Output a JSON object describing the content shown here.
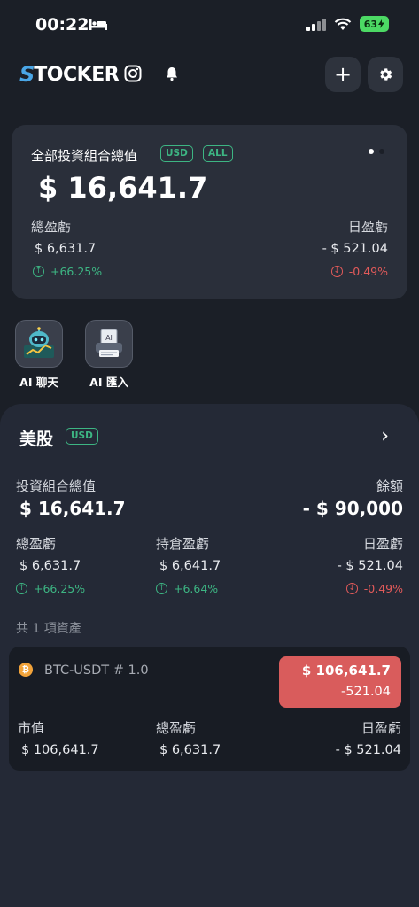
{
  "status": {
    "time": "00:22",
    "battery": "63"
  },
  "header": {
    "logo_s": "S",
    "logo_text": "TOCKER",
    "add_label": "+"
  },
  "portfolio": {
    "title": "全部投資組合總值",
    "tag_currency": "USD",
    "tag_scope": "ALL",
    "total": "$ 16,641.7",
    "total_pl_label": "總盈虧",
    "total_pl_value": "$ 6,631.7",
    "total_pl_pct": "+66.25%",
    "day_pl_label": "日盈虧",
    "day_pl_value": "- $ 521.04",
    "day_pl_pct": "-0.49%"
  },
  "ai": {
    "chat_label": "AI 聊天",
    "import_label": "AI 匯入"
  },
  "market": {
    "title": "美股",
    "tag": "USD",
    "chevron": "›",
    "value_label": "投資組合總值",
    "value": "$ 16,641.7",
    "balance_label": "餘額",
    "balance": "- $ 90,000",
    "total_pl_label": "總盈虧",
    "total_pl_value": "$ 6,631.7",
    "total_pl_pct": "+66.25%",
    "holding_pl_label": "持倉盈虧",
    "holding_pl_value": "$ 6,641.7",
    "holding_pl_pct": "+6.64%",
    "day_pl_label": "日盈虧",
    "day_pl_value": "- $ 521.04",
    "day_pl_pct": "-0.49%",
    "asset_count": "共 1 項資產"
  },
  "asset": {
    "icon_glyph": "₿",
    "name": "BTC-USDT",
    "qty": "# 1.0",
    "price": "$ 106,641.7",
    "change": "-521.04",
    "market_value_label": "市值",
    "market_value": "$ 106,641.7",
    "total_pl_label": "總盈虧",
    "total_pl_value": "$ 6,631.7",
    "day_pl_label": "日盈虧",
    "day_pl_value": "- $ 521.04"
  },
  "colors": {
    "up": "#3db583",
    "down": "#e25a5a",
    "logo_accent": "#4aa6e6"
  }
}
